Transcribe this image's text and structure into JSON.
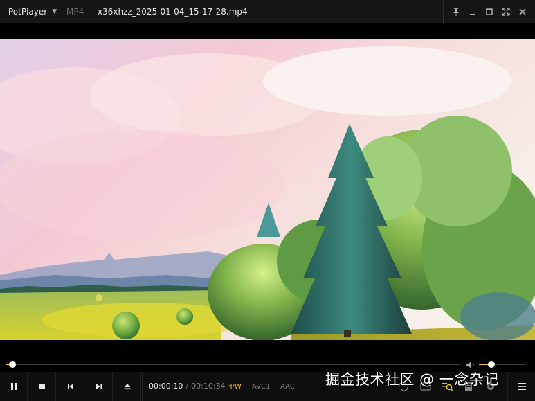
{
  "app": {
    "brand": "PotPlayer",
    "format": "MP4",
    "filename": "x36xhzz_2025-01-04_15-17-28.mp4"
  },
  "icons": {
    "brand_menu": "chevron-down-icon",
    "pin": "pin-icon",
    "minimize": "minimize-icon",
    "maximize": "maximize-icon",
    "fullscreen": "fullscreen-icon",
    "close": "close-icon",
    "pause": "pause-icon",
    "stop": "stop-icon",
    "prev": "skip-previous-icon",
    "next": "skip-next-icon",
    "eject": "eject-icon",
    "volume": "speaker-icon",
    "playlist": "menu-icon"
  },
  "playback": {
    "current_time": "00:00:10",
    "separator": "/",
    "total_time": "00:10:34",
    "progress": 0.016,
    "volume": 0.26
  },
  "badges": {
    "hw": "H/W",
    "video_codec": "AVC1",
    "audio_codec": "AAC"
  },
  "watermark": "掘金技术社区 @ 一念杂记",
  "colors": {
    "accent": "#f0c61c",
    "titlebar": "#161616",
    "controlbar": "#0e0e0e"
  }
}
